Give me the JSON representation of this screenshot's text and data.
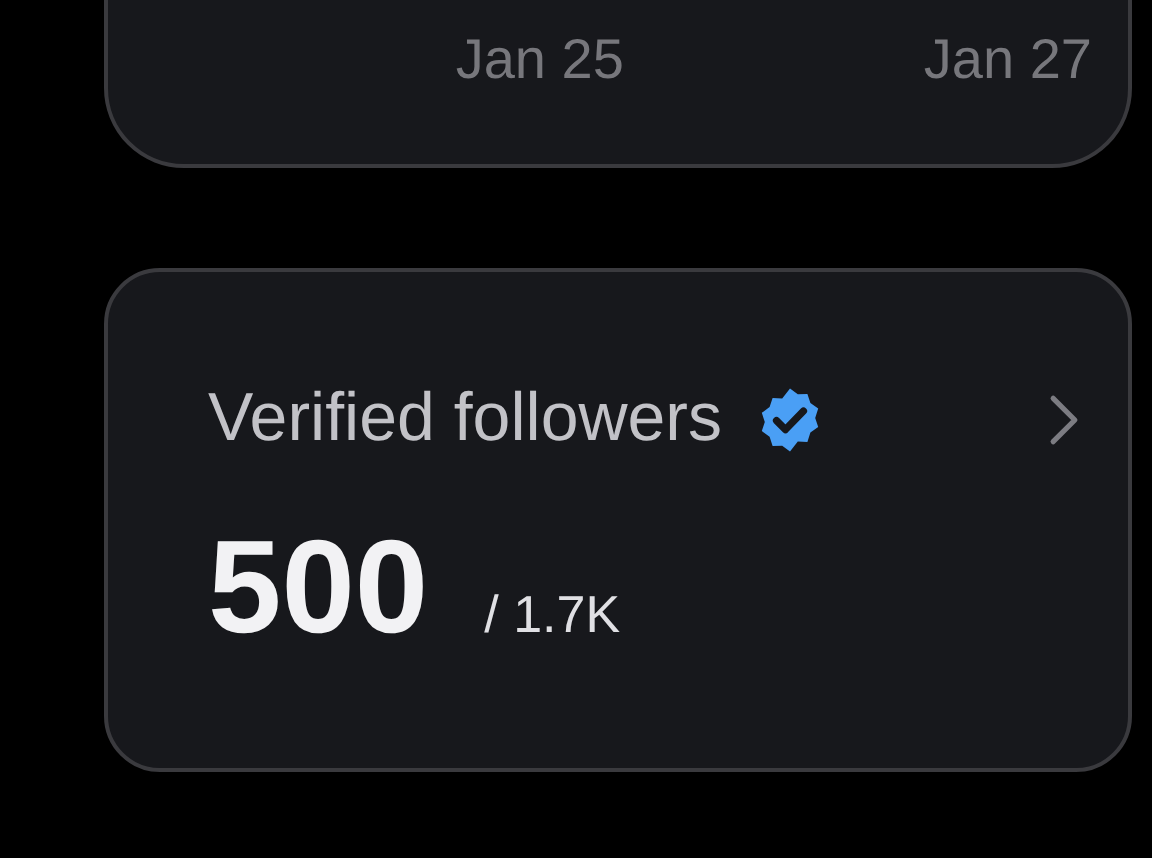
{
  "chart_card": {
    "x_labels": [
      "Jan 25",
      "Jan 27"
    ]
  },
  "verified_card": {
    "title": "Verified followers",
    "value": "500",
    "total": "/ 1.7K"
  }
}
